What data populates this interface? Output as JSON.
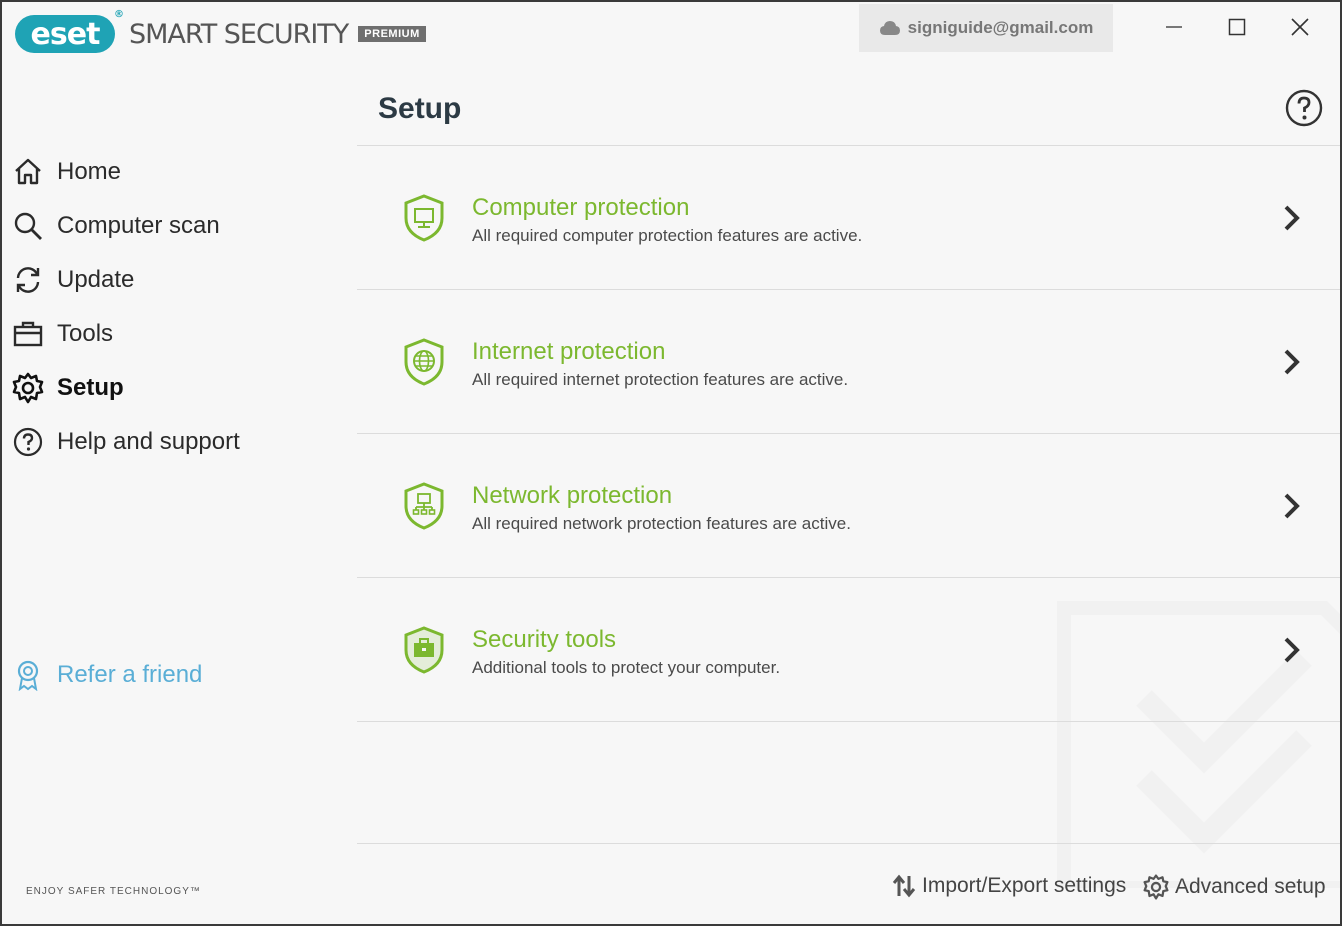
{
  "app": {
    "brand": "eset",
    "product": "SMART SECURITY",
    "edition": "PREMIUM",
    "account_email": "signiguide@gmail.com",
    "tagline": "ENJOY SAFER TECHNOLOGY™"
  },
  "colors": {
    "brand_teal": "#1fa3b5",
    "accent_green": "#7cb82f",
    "link_blue": "#5aaed6"
  },
  "sidebar": {
    "items": [
      {
        "label": "Home",
        "icon": "home-icon"
      },
      {
        "label": "Computer scan",
        "icon": "search-icon"
      },
      {
        "label": "Update",
        "icon": "refresh-icon"
      },
      {
        "label": "Tools",
        "icon": "toolbox-icon"
      },
      {
        "label": "Setup",
        "icon": "gear-icon",
        "active": true
      },
      {
        "label": "Help and support",
        "icon": "question-circle-icon"
      }
    ],
    "refer": {
      "label": "Refer a friend",
      "icon": "award-ribbon-icon"
    }
  },
  "main": {
    "title": "Setup",
    "cards": [
      {
        "title": "Computer protection",
        "desc": "All required computer protection features are active.",
        "icon": "shield-monitor-icon"
      },
      {
        "title": "Internet protection",
        "desc": "All required internet protection features are active.",
        "icon": "shield-globe-icon"
      },
      {
        "title": "Network protection",
        "desc": "All required network protection features are active.",
        "icon": "shield-network-icon"
      },
      {
        "title": "Security tools",
        "desc": "Additional tools to protect your computer.",
        "icon": "shield-toolbox-icon"
      }
    ],
    "footer": {
      "import_export": "Import/Export settings",
      "advanced_setup": "Advanced setup"
    }
  }
}
